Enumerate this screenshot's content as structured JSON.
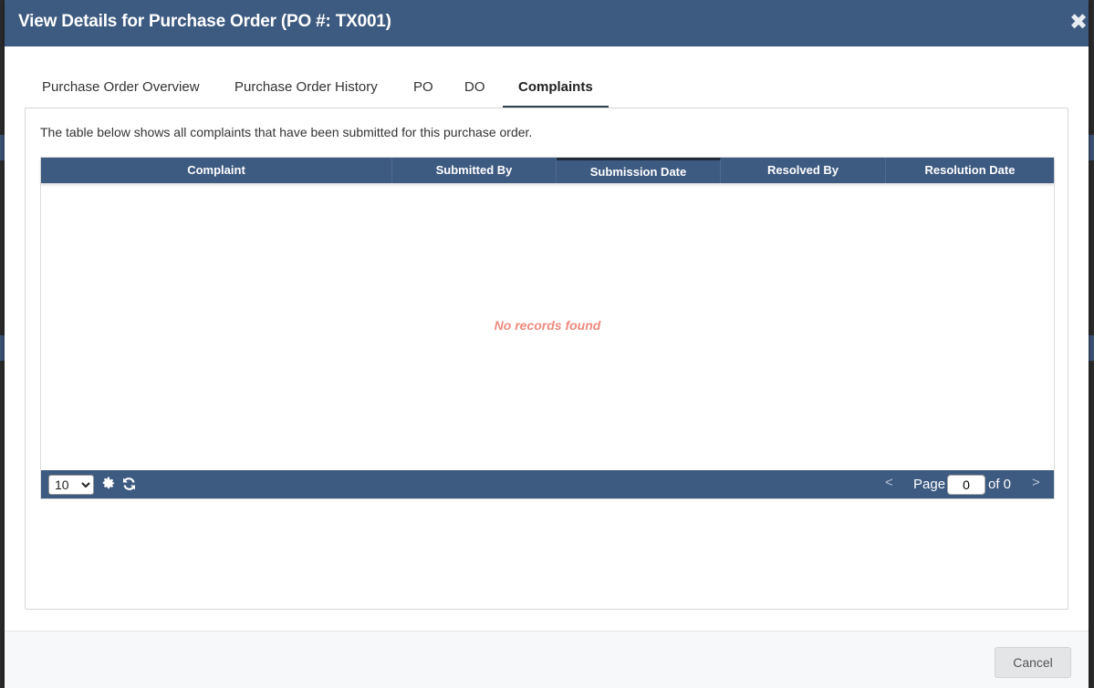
{
  "modal": {
    "title": "View Details for Purchase Order (PO #: TX001)",
    "close_glyph": "✖"
  },
  "tabs": [
    {
      "label": "Purchase Order Overview"
    },
    {
      "label": "Purchase Order History"
    },
    {
      "label": "PO"
    },
    {
      "label": "DO"
    },
    {
      "label": "Complaints",
      "active": true
    }
  ],
  "panel": {
    "description": "The table below shows all complaints that have been submitted for this purchase order."
  },
  "grid": {
    "columns": [
      "Complaint",
      "Submitted By",
      "Submission Date",
      "Resolved By",
      "Resolution Date"
    ],
    "sorted_column": "Submission Date",
    "empty_message": "No records found"
  },
  "pager": {
    "page_size": "10",
    "page_size_options": [
      "10"
    ],
    "page_label": "Page",
    "page_value": "0",
    "of_label": "of 0",
    "prev_glyph": "<",
    "next_glyph": ">",
    "settings_icon": "gear-icon",
    "refresh_icon": "refresh-icon"
  },
  "footer": {
    "cancel_label": "Cancel"
  },
  "colors": {
    "header": "#3d5a80",
    "empty_text": "#f08a7e"
  }
}
